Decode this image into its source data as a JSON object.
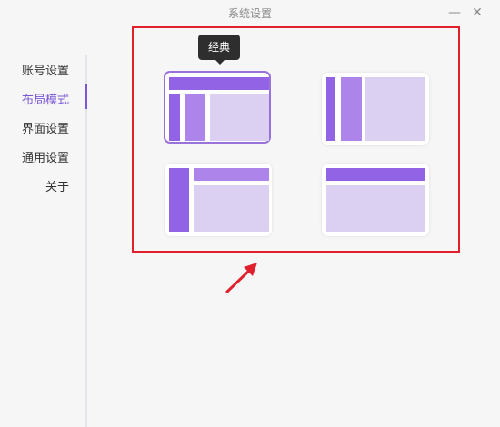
{
  "window": {
    "title": "系统设置",
    "minimize_glyph": "—",
    "close_glyph": "✕"
  },
  "sidebar": {
    "items": [
      {
        "label": "账号设置",
        "active": false
      },
      {
        "label": "布局模式",
        "active": true
      },
      {
        "label": "界面设置",
        "active": false
      },
      {
        "label": "通用设置",
        "active": false
      },
      {
        "label": "关于",
        "active": false
      }
    ]
  },
  "layouts": {
    "tooltip": "经典",
    "options": [
      {
        "id": "classic",
        "selected": true
      },
      {
        "id": "double-sidebar",
        "selected": false
      },
      {
        "id": "sidebar-header",
        "selected": false
      },
      {
        "id": "top-header",
        "selected": false
      }
    ]
  },
  "colors": {
    "accent": "#7a56d8",
    "layout_dark": "#9363e6",
    "layout_mid": "#ad85ea",
    "layout_light": "#dcd0f2",
    "annotation_red": "#e0212d"
  },
  "icons": {
    "annotation": "red-arrow-icon"
  }
}
